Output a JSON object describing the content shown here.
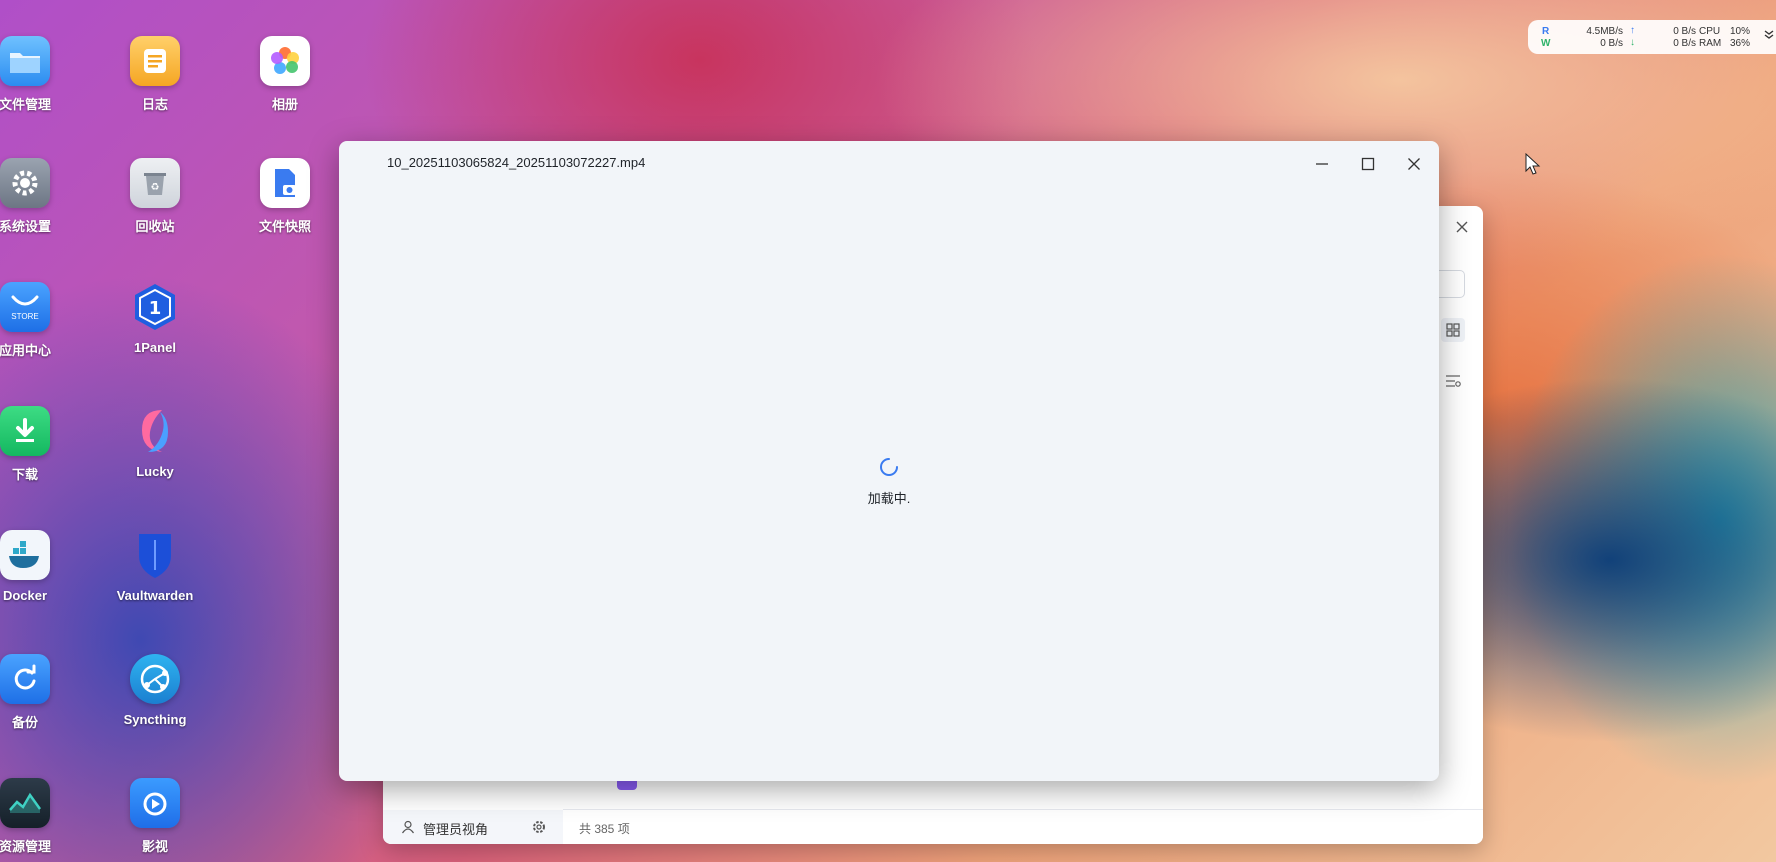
{
  "desktop": {
    "icons": [
      {
        "label": "文件管理",
        "icon": "folder-icon"
      },
      {
        "label": "日志",
        "icon": "notes-icon"
      },
      {
        "label": "相册",
        "icon": "photos-icon"
      },
      {
        "label": "系统设置",
        "icon": "gear-icon"
      },
      {
        "label": "回收站",
        "icon": "recycle-icon"
      },
      {
        "label": "文件快照",
        "icon": "snapshot-icon"
      },
      {
        "label": "应用中心",
        "icon": "store-icon",
        "badge": "STORE"
      },
      {
        "label": "1Panel",
        "icon": "1panel-icon"
      },
      {
        "label": "下载",
        "icon": "download-icon"
      },
      {
        "label": "Lucky",
        "icon": "lucky-icon"
      },
      {
        "label": "Docker",
        "icon": "docker-icon"
      },
      {
        "label": "Vaultwarden",
        "icon": "shield-icon"
      },
      {
        "label": "备份",
        "icon": "backup-icon"
      },
      {
        "label": "Syncthing",
        "icon": "syncthing-icon"
      },
      {
        "label": "资源管理",
        "icon": "monitor-icon"
      },
      {
        "label": "影视",
        "icon": "video-icon"
      }
    ]
  },
  "sysmon": {
    "r_label": "R",
    "w_label": "W",
    "r_disk": "4.5MB/s",
    "w_disk": "0 B/s",
    "r_net": "0 B/s",
    "w_net": "0 B/s",
    "cpu_label": "CPU",
    "cpu_value": "10%",
    "ram_label": "RAM",
    "ram_value": "36%"
  },
  "file_manager": {
    "footer_role": "管理员视角",
    "item_count": "共 385 项"
  },
  "player": {
    "filename": "10_20251103065824_20251103072227.mp4",
    "loading_text": "加载中."
  },
  "colors": {
    "accent": "#3a7bf0",
    "up_arrow": "#3a7bf0",
    "down_arrow": "#2fb36a"
  }
}
